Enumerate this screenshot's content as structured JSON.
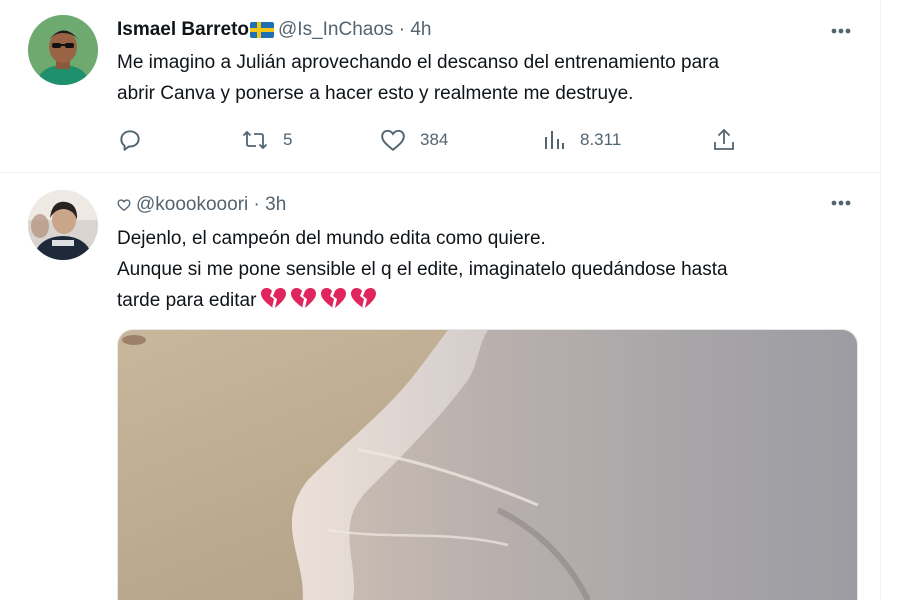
{
  "tweets": [
    {
      "display_name": "Ismael Barreto",
      "handle": "@Is_InChaos",
      "separator": "·",
      "time": "4h",
      "text_lines": [
        "Me imagino a Julián aprovechando el descanso del entrenamiento para",
        "abrir Canva y ponerse a hacer esto y realmente me destruye."
      ],
      "actions": {
        "reply": "",
        "retweets": "5",
        "likes": "384",
        "views": "8.311"
      },
      "flag_icon": "sweden-flag-icon"
    },
    {
      "handle": "@koookooori",
      "separator": "·",
      "time": "3h",
      "text_lines": [
        "Dejenlo, el campeón del mundo edita como quiere.",
        "Aunque si me pone sensible el q el edite, imaginatelo quedándose hasta",
        "tarde para editar"
      ],
      "emoji": "broken-heart-icon x4"
    }
  ],
  "colors": {
    "text": "#0f1419",
    "muted": "#536471",
    "divider": "#eff3f4",
    "broken_heart": "#e0245e"
  }
}
